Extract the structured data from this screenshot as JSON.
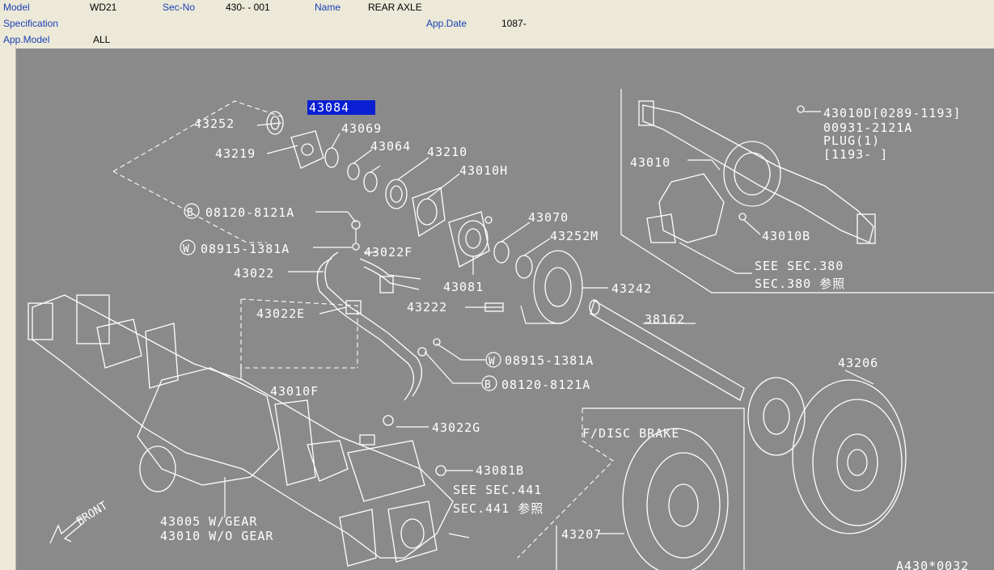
{
  "header": {
    "model_label": "Model",
    "model_value": "WD21",
    "secno_label": "Sec-No",
    "secno_value": "430-  - 001",
    "name_label": "Name",
    "name_value": "REAR AXLE",
    "spec_label": "Specification",
    "spec_value": "",
    "appdate_label": "App.Date",
    "appdate_value": "1087-",
    "appmodel_label": "App.Model",
    "appmodel_value": "ALL"
  },
  "diagram": {
    "selected_part": "43084",
    "parts": {
      "p43252": "43252",
      "p43219": "43219",
      "p43069": "43069",
      "p43064": "43064",
      "p43210": "43210",
      "p43010H": "43010H",
      "p08120a": "08120-8121A",
      "p08915a": "08915-1381A",
      "p43022F": "43022F",
      "p43022": "43022",
      "p43070": "43070",
      "p43252M": "43252M",
      "p43081": "43081",
      "p43242": "43242",
      "p43222": "43222",
      "p43022E": "43022E",
      "p38162": "38162",
      "p08915b": "08915-1381A",
      "p08120b": "08120-8121A",
      "p43206": "43206",
      "p43010F": "43010F",
      "p43022G": "43022G",
      "p43081B": "43081B",
      "fdisc": "F/DISC BRAKE",
      "seesec441": "SEE SEC.441",
      "sec441ref": "SEC.441 参照",
      "p43005": "43005 W/GEAR",
      "p43010wo": "43010 W/O GEAR",
      "p43207": "43207",
      "front": "FRONT",
      "p43010D": "43010D[0289-1193]",
      "plug_pn": "00931-2121A",
      "plug": "PLUG(1)",
      "plug_date": "[1193-     ]",
      "p43010": "43010",
      "p43010B": "43010B",
      "seesec380": "SEE SEC.380",
      "sec380ref": "SEC.380 参照",
      "footer": "A430*0032"
    }
  }
}
